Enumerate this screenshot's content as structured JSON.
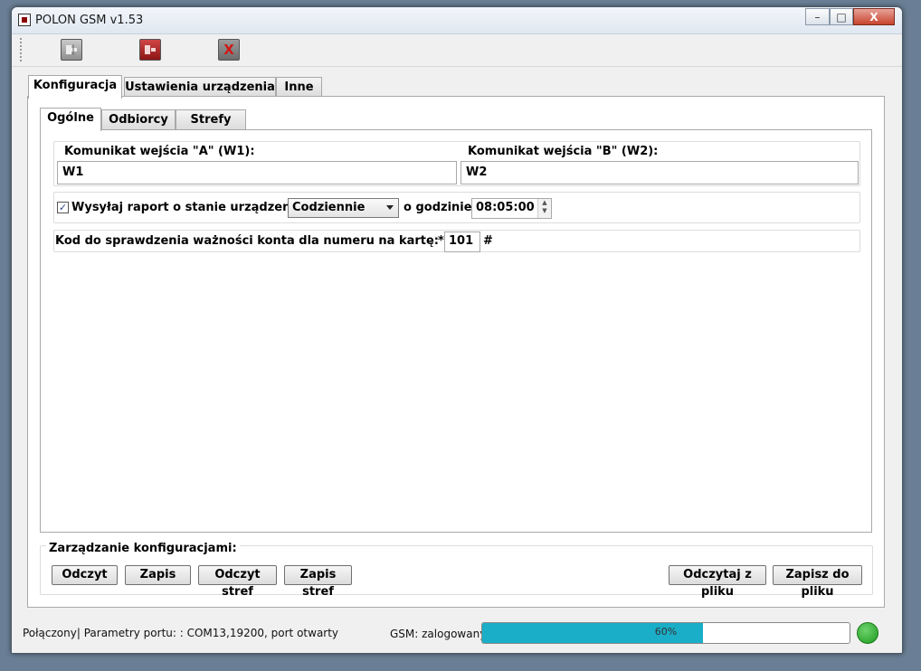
{
  "window": {
    "title": "POLON GSM v1.53"
  },
  "titlebar_buttons": {
    "minimize": "–",
    "maximize": "□",
    "close": "X"
  },
  "toolbar": {
    "connect_icon": "connect-plug-icon",
    "disconnect_icon": "disconnect-plug-icon",
    "close_icon": "close-x-icon",
    "close_glyph": "X"
  },
  "main_tabs": [
    "Konfiguracja",
    "Ustawienia urządzenia",
    "Inne"
  ],
  "sub_tabs": [
    "Ogólne",
    "Odbiorcy",
    "Strefy"
  ],
  "messages": {
    "a_label": "Komunikat wejścia \"A\" (W1):",
    "a_value": "W1",
    "b_label": "Komunikat wejścia \"B\" (W2):",
    "b_value": "W2"
  },
  "report": {
    "checked": true,
    "check_mark": "✓",
    "label": "Wysyłaj raport o stanie urządzenia.",
    "frequency": "Codziennie",
    "time_label": "o godzinie:",
    "time": "08:05:00",
    "spin_up": "▲",
    "spin_down": "▼"
  },
  "code": {
    "label": "Kod do sprawdzenia ważności konta dla numeru na kartę:",
    "prefix": "*",
    "value": "101",
    "suffix": "#"
  },
  "config_mgmt": {
    "label": "Zarządzanie konfiguracjami:",
    "read": "Odczyt",
    "write": "Zapis",
    "read_zones": "Odczyt stref",
    "write_zones": "Zapis stref",
    "read_file": "Odczytaj z pliku",
    "write_file": "Zapisz do pliku"
  },
  "status": {
    "connection": "Połączony| Parametry portu: : COM13,19200, port otwarty",
    "gsm": "GSM: zalogowany",
    "progress_percent": 60,
    "progress_label": "60%",
    "led_color": "#2eaa2e"
  },
  "colors": {
    "progress_fill": "#1aaec8",
    "toolbar_red": "#b02020",
    "toolbar_gray": "#9a9a9a"
  }
}
